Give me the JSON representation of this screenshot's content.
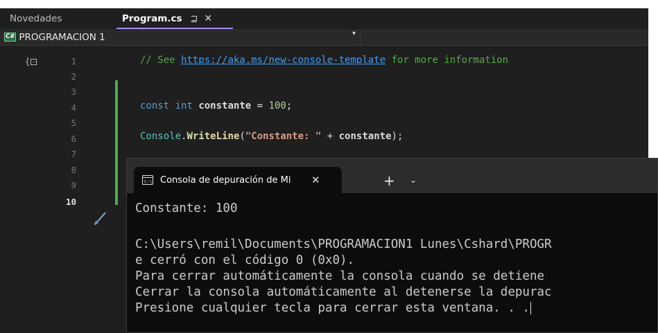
{
  "tabs": {
    "novedades": "Novedades",
    "program": "Program.cs",
    "pin_glyph": "⊒",
    "close_glyph": "✕"
  },
  "navbar": {
    "cs_badge": "C#",
    "project": "PROGRAMACION 1",
    "dropdown_glyph": "▾"
  },
  "editor": {
    "line_numbers": [
      "1",
      "2",
      "3",
      "4",
      "5",
      "6",
      "7",
      "8",
      "9",
      "10"
    ],
    "current_line": "10",
    "fold_glyph": "{",
    "line1": {
      "comment_prefix": "// See ",
      "link": "https://aka.ms/new-console-template",
      "comment_suffix": " for more information"
    },
    "line3": {
      "kw1": "const",
      "kw2": "int",
      "ident": "constante",
      "op": " = ",
      "num": "100",
      "end": ";"
    },
    "line5": {
      "cls": "Console",
      "dot": ".",
      "meth": "WriteLine",
      "open": "(",
      "str": "\"Constante: \"",
      "plus": " + ",
      "ident": "constante",
      "close": ");"
    }
  },
  "terminal": {
    "tab_icon": "C:\\",
    "tab_title": "Consola de depuración de Mi",
    "tab_close": "✕",
    "new_tab": "+",
    "dropdown": "⌄",
    "lines": [
      "Constante: 100",
      "",
      "C:\\Users\\remil\\Documents\\PROGRAMACION1 Lunes\\Cshard\\PROGR",
      "e cerró con el código 0 (0x0).",
      "Para cerrar automáticamente la consola cuando se detiene",
      "Cerrar la consola automáticamente al detenerse la depurac",
      "Presione cualquier tecla para cerrar esta ventana. . ."
    ]
  },
  "colors": {
    "accent": "#a78bfa",
    "change_bar": "#5aa35a",
    "keyword": "#569cd6",
    "string": "#d69d85",
    "comment": "#57a64a",
    "type": "#4ec9b0"
  }
}
